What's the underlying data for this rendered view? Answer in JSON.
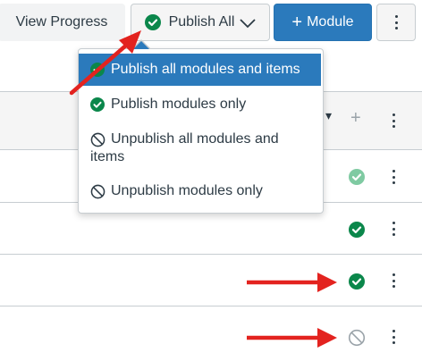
{
  "toolbar": {
    "view_progress_label": "View Progress",
    "publish_all_label": "Publish All",
    "module_label": "Module",
    "module_plus": "+"
  },
  "publish_menu": {
    "items": [
      {
        "label": "Publish all modules and items",
        "icon": "check-circle-icon",
        "selected": true
      },
      {
        "label": "Publish modules only",
        "icon": "check-circle-icon"
      },
      {
        "label": "Unpublish all modules and items",
        "icon": "unpublished-icon"
      },
      {
        "label": "Unpublish modules only",
        "icon": "unpublished-icon"
      }
    ]
  },
  "module_header": {
    "caret": "▾",
    "add": "+"
  },
  "module_items": [
    {
      "status": "published-light"
    },
    {
      "status": "published"
    },
    {
      "status": "published"
    },
    {
      "status": "unpublished"
    }
  ],
  "colors": {
    "published_green": "#0b874b",
    "published_light_green": "#7fcaa2",
    "primary_blue": "#2b7abc",
    "annotation_red": "#e3231f",
    "border_gray": "#c7cdd1"
  }
}
